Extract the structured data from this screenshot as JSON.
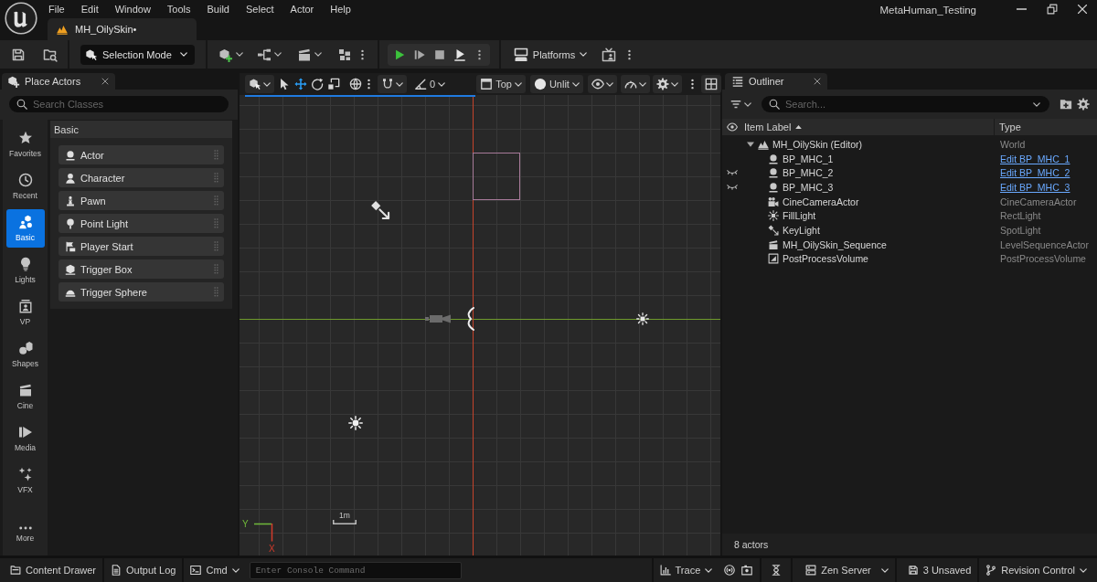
{
  "app_menu": [
    "File",
    "Edit",
    "Window",
    "Tools",
    "Build",
    "Select",
    "Actor",
    "Help"
  ],
  "level_tab": {
    "label": "MH_OilySkin•"
  },
  "project_title": "MetaHuman_Testing",
  "main_toolbar": {
    "mode": "Selection Mode",
    "platforms": "Platforms"
  },
  "place_actors": {
    "tab": "Place Actors",
    "search_placeholder": "Search Classes",
    "categories": [
      {
        "label": "Favorites",
        "kind": "favorites",
        "selected": false
      },
      {
        "label": "Recent",
        "kind": "recent",
        "selected": false
      },
      {
        "label": "Basic",
        "kind": "basic",
        "selected": true
      },
      {
        "label": "Lights",
        "kind": "lights",
        "selected": false
      },
      {
        "label": "VP",
        "kind": "vp",
        "selected": false
      },
      {
        "label": "Shapes",
        "kind": "shapes",
        "selected": false
      },
      {
        "label": "Cine",
        "kind": "cine",
        "selected": false
      },
      {
        "label": "Media",
        "kind": "media",
        "selected": false
      },
      {
        "label": "VFX",
        "kind": "vfx",
        "selected": false
      },
      {
        "label": "More",
        "kind": "more",
        "selected": false
      }
    ],
    "section": "Basic",
    "items": [
      {
        "label": "Actor",
        "kind": "actor"
      },
      {
        "label": "Character",
        "kind": "character"
      },
      {
        "label": "Pawn",
        "kind": "pawn"
      },
      {
        "label": "Point Light",
        "kind": "pointlight"
      },
      {
        "label": "Player Start",
        "kind": "playerstart"
      },
      {
        "label": "Trigger Box",
        "kind": "triggerbox"
      },
      {
        "label": "Trigger Sphere",
        "kind": "triggersphere"
      }
    ]
  },
  "viewport": {
    "transform_tools": [
      {
        "kind": "select",
        "selected": false
      },
      {
        "kind": "translate",
        "selected": true
      },
      {
        "kind": "rotate",
        "selected": false
      },
      {
        "kind": "scale",
        "selected": false
      }
    ],
    "snap_value": "0",
    "view": "Top",
    "view_mode": "Unlit",
    "axis_labels": {
      "y": "Y",
      "x": "X"
    },
    "scale_label": "1m"
  },
  "outliner": {
    "tab": "Outliner",
    "search_placeholder": "Search...",
    "columns": [
      {
        "label": "Item Label",
        "sorted": true
      },
      {
        "label": "Type",
        "sorted": false
      }
    ],
    "tree": [
      {
        "label": "MH_OilySkin (Editor)",
        "kind": "world",
        "type": "World",
        "type_link": false,
        "hidden": false,
        "expanded": true,
        "children": [
          {
            "label": "BP_MHC_1",
            "kind": "blueprint",
            "type": "Edit BP_MHC_1",
            "type_link": true,
            "hidden": false
          },
          {
            "label": "BP_MHC_2",
            "kind": "blueprint",
            "type": "Edit BP_MHC_2",
            "type_link": true,
            "hidden": true
          },
          {
            "label": "BP_MHC_3",
            "kind": "blueprint",
            "type": "Edit BP_MHC_3",
            "type_link": true,
            "hidden": true
          },
          {
            "label": "CineCameraActor",
            "kind": "camera",
            "type": "CineCameraActor",
            "type_link": false,
            "hidden": false
          },
          {
            "label": "FillLight",
            "kind": "rectlight",
            "type": "RectLight",
            "type_link": false,
            "hidden": false
          },
          {
            "label": "KeyLight",
            "kind": "spotlight",
            "type": "SpotLight",
            "type_link": false,
            "hidden": false
          },
          {
            "label": "MH_OilySkin_Sequence",
            "kind": "sequence",
            "type": "LevelSequenceActor",
            "type_link": false,
            "hidden": false
          },
          {
            "label": "PostProcessVolume",
            "kind": "postprocess",
            "type": "PostProcessVolume",
            "type_link": false,
            "hidden": false
          }
        ]
      }
    ],
    "footer": "8 actors"
  },
  "status_bar": {
    "content_drawer": "Content Drawer",
    "output_log": "Output Log",
    "cmd": "Cmd",
    "console_placeholder": "Enter Console Command",
    "trace": "Trace",
    "zen_server": "Zen Server",
    "unsaved": "3 Unsaved",
    "revision_control": "Revision Control"
  }
}
